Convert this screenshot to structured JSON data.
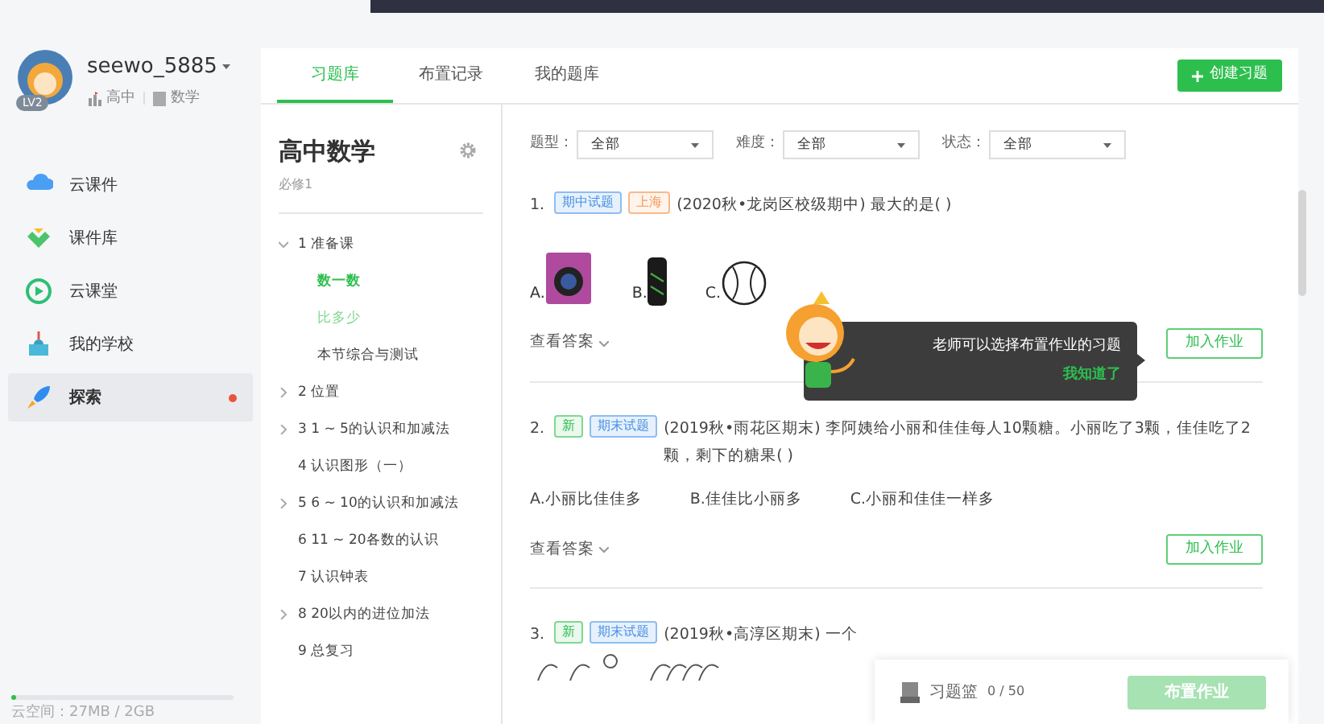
{
  "user": {
    "name": "seewo_5885",
    "level": "LV2",
    "stage": "高中",
    "subject": "数学"
  },
  "nav": [
    {
      "label": "云课件",
      "selected": false,
      "dot": false
    },
    {
      "label": "课件库",
      "selected": false,
      "dot": false
    },
    {
      "label": "云课堂",
      "selected": false,
      "dot": false
    },
    {
      "label": "我的学校",
      "selected": false,
      "dot": false
    },
    {
      "label": "探索",
      "selected": true,
      "dot": true
    }
  ],
  "storage": {
    "label": "云空间：27MB / 2GB",
    "level": 0.02
  },
  "tabs": [
    {
      "label": "习题库",
      "selected": true
    },
    {
      "label": "布置记录",
      "selected": false
    },
    {
      "label": "我的题库",
      "selected": false
    }
  ],
  "create_button": "创建习题",
  "book": {
    "title": "高中数学",
    "subtitle": "必修1"
  },
  "tree": [
    {
      "label": "1 准备课",
      "expanded": true,
      "children": [
        {
          "label": "数一数",
          "selected": true,
          "hovered": false
        },
        {
          "label": "比多少",
          "selected": false,
          "hovered": true
        },
        {
          "label": "本节综合与测试",
          "selected": false,
          "hovered": false
        }
      ]
    },
    {
      "label": "2 位置",
      "expanded": false
    },
    {
      "label": "3 1 ~ 5的认识和加减法",
      "expanded": false
    },
    {
      "label": "4 认识图形（一）"
    },
    {
      "label": "5 6 ~ 10的认识和加减法",
      "expanded": false
    },
    {
      "label": "6 11 ~ 20各数的认识"
    },
    {
      "label": "7 认识钟表"
    },
    {
      "label": "8 20以内的进位加法",
      "expanded": false
    },
    {
      "label": "9 总复习"
    }
  ],
  "filters": [
    {
      "label": "题型：",
      "value": "全部"
    },
    {
      "label": "难度：",
      "value": "全部"
    },
    {
      "label": "状态：",
      "value": "全部"
    }
  ],
  "questions": [
    {
      "number": "1.",
      "tags": [
        {
          "text": "期中试题",
          "kind": "exam"
        },
        {
          "text": "上海",
          "kind": "region"
        }
      ],
      "text": "(2020秋•龙岗区校级期中) 最大的是(        )",
      "kind": "images",
      "options": [
        {
          "letter": "A."
        },
        {
          "letter": "B."
        },
        {
          "letter": "C."
        }
      ],
      "answer_link": "查看答案",
      "add_button": "加入作业"
    },
    {
      "number": "2.",
      "tags": [
        {
          "text": "新",
          "kind": "new"
        },
        {
          "text": "期末试题",
          "kind": "exam"
        }
      ],
      "text": "(2019秋•雨花区期末) 李阿姨给小丽和佳佳每人10颗糖。小丽吃了3颗，佳佳吃了2颗，剩下的糖果(        )",
      "kind": "text",
      "options": [
        {
          "text": "A.小丽比佳佳多"
        },
        {
          "text": "B.佳佳比小丽多"
        },
        {
          "text": "C.小丽和佳佳一样多"
        }
      ],
      "answer_link": "查看答案",
      "add_button": "加入作业"
    },
    {
      "number": "3.",
      "tags": [
        {
          "text": "新",
          "kind": "new"
        },
        {
          "text": "期末试题",
          "kind": "exam"
        }
      ],
      "text": "(2019秋•高淳区期末) 一个",
      "kind": "drawing"
    }
  ],
  "tip": {
    "text": "老师可以选择布置作业的习题",
    "action": "我知道了"
  },
  "basket": {
    "label": "习题篮",
    "count": "0 / 50",
    "button": "布置作业"
  }
}
